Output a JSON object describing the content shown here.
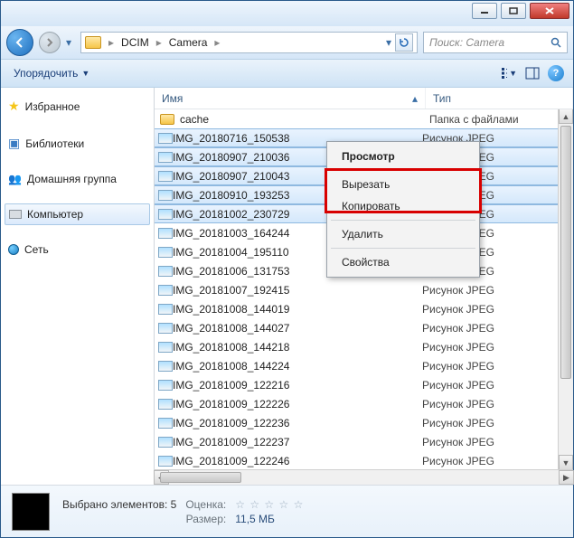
{
  "breadcrumb": {
    "items": [
      "DCIM",
      "Camera"
    ]
  },
  "search": {
    "placeholder": "Поиск: Camera"
  },
  "toolbar": {
    "organize": "Упорядочить"
  },
  "columns": {
    "name": "Имя",
    "type": "Тип"
  },
  "sidebar": {
    "favorites": "Избранное",
    "libraries": "Библиотеки",
    "homegroup": "Домашняя группа",
    "computer": "Компьютер",
    "network": "Сеть"
  },
  "files": [
    {
      "name": "cache",
      "type": "Папка с файлами",
      "kind": "folder",
      "selected": false
    },
    {
      "name": "IMG_20180716_150538",
      "type": "Рисунок JPEG",
      "kind": "image",
      "selected": true
    },
    {
      "name": "IMG_20180907_210036",
      "type": "Рисунок JPEG",
      "kind": "image",
      "selected": true
    },
    {
      "name": "IMG_20180907_210043",
      "type": "Рисунок JPEG",
      "kind": "image",
      "selected": true
    },
    {
      "name": "IMG_20180910_193253",
      "type": "Рисунок JPEG",
      "kind": "image",
      "selected": true
    },
    {
      "name": "IMG_20181002_230729",
      "type": "Рисунок JPEG",
      "kind": "image",
      "selected": true
    },
    {
      "name": "IMG_20181003_164244",
      "type": "Рисунок JPEG",
      "kind": "image",
      "selected": false
    },
    {
      "name": "IMG_20181004_195110",
      "type": "Рисунок JPEG",
      "kind": "image",
      "selected": false
    },
    {
      "name": "IMG_20181006_131753",
      "type": "Рисунок JPEG",
      "kind": "image",
      "selected": false
    },
    {
      "name": "IMG_20181007_192415",
      "type": "Рисунок JPEG",
      "kind": "image",
      "selected": false
    },
    {
      "name": "IMG_20181008_144019",
      "type": "Рисунок JPEG",
      "kind": "image",
      "selected": false
    },
    {
      "name": "IMG_20181008_144027",
      "type": "Рисунок JPEG",
      "kind": "image",
      "selected": false
    },
    {
      "name": "IMG_20181008_144218",
      "type": "Рисунок JPEG",
      "kind": "image",
      "selected": false
    },
    {
      "name": "IMG_20181008_144224",
      "type": "Рисунок JPEG",
      "kind": "image",
      "selected": false
    },
    {
      "name": "IMG_20181009_122216",
      "type": "Рисунок JPEG",
      "kind": "image",
      "selected": false
    },
    {
      "name": "IMG_20181009_122226",
      "type": "Рисунок JPEG",
      "kind": "image",
      "selected": false
    },
    {
      "name": "IMG_20181009_122236",
      "type": "Рисунок JPEG",
      "kind": "image",
      "selected": false
    },
    {
      "name": "IMG_20181009_122237",
      "type": "Рисунок JPEG",
      "kind": "image",
      "selected": false
    },
    {
      "name": "IMG_20181009_122246",
      "type": "Рисунок JPEG",
      "kind": "image",
      "selected": false
    }
  ],
  "context_menu": {
    "view": "Просмотр",
    "cut": "Вырезать",
    "copy": "Копировать",
    "delete": "Удалить",
    "properties": "Свойства"
  },
  "details": {
    "selected_label": "Выбрано элементов: 5",
    "rating_label": "Оценка:",
    "size_label": "Размер:",
    "size_value": "11,5 МБ"
  }
}
